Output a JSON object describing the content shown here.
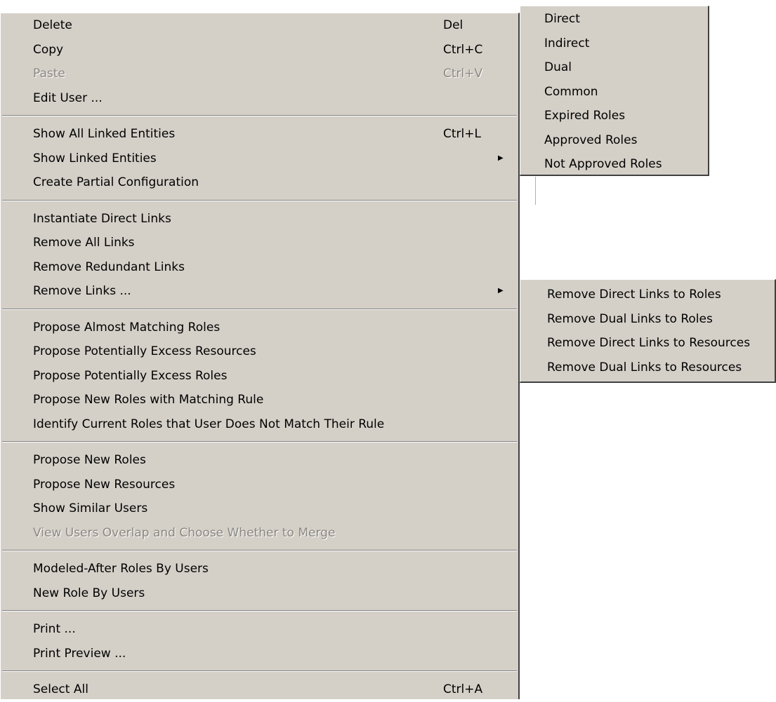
{
  "main_menu": {
    "groups": [
      [
        {
          "label": "Delete",
          "shortcut": "Del",
          "disabled": false
        },
        {
          "label": "Copy",
          "shortcut": "Ctrl+C",
          "disabled": false
        },
        {
          "label": "Paste",
          "shortcut": "Ctrl+V",
          "disabled": true
        },
        {
          "label": "Edit User ...",
          "shortcut": "",
          "disabled": false
        }
      ],
      [
        {
          "label": "Show All Linked Entities",
          "shortcut": "Ctrl+L",
          "disabled": false
        },
        {
          "label": "Show Linked Entities",
          "shortcut": "",
          "submenu": true,
          "disabled": false
        },
        {
          "label": "Create Partial Configuration",
          "shortcut": "",
          "disabled": false
        }
      ],
      [
        {
          "label": "Instantiate Direct Links",
          "shortcut": "",
          "disabled": false
        },
        {
          "label": "Remove All Links",
          "shortcut": "",
          "disabled": false
        },
        {
          "label": "Remove Redundant Links",
          "shortcut": "",
          "disabled": false
        },
        {
          "label": "Remove Links ...",
          "shortcut": "",
          "submenu": true,
          "disabled": false
        }
      ],
      [
        {
          "label": "Propose Almost Matching Roles",
          "shortcut": "",
          "disabled": false
        },
        {
          "label": "Propose Potentially Excess Resources",
          "shortcut": "",
          "disabled": false
        },
        {
          "label": "Propose Potentially Excess Roles",
          "shortcut": "",
          "disabled": false
        },
        {
          "label": "Propose New Roles with Matching Rule",
          "shortcut": "",
          "disabled": false
        },
        {
          "label": "Identify Current Roles that User Does Not Match Their Rule",
          "shortcut": "",
          "disabled": false
        }
      ],
      [
        {
          "label": "Propose New Roles",
          "shortcut": "",
          "disabled": false
        },
        {
          "label": "Propose New Resources",
          "shortcut": "",
          "disabled": false
        },
        {
          "label": "Show Similar Users",
          "shortcut": "",
          "disabled": false
        },
        {
          "label": "View Users Overlap and Choose Whether to Merge",
          "shortcut": "",
          "disabled": true
        }
      ],
      [
        {
          "label": "Modeled-After Roles By Users",
          "shortcut": "",
          "disabled": false
        },
        {
          "label": "New Role By Users",
          "shortcut": "",
          "disabled": false
        }
      ],
      [
        {
          "label": "Print ...",
          "shortcut": "",
          "disabled": false
        },
        {
          "label": "Print Preview ...",
          "shortcut": "",
          "disabled": false
        }
      ],
      [
        {
          "label": "Select All",
          "shortcut": "Ctrl+A",
          "disabled": false
        }
      ]
    ]
  },
  "submenu_linked_entities": {
    "items": [
      "Direct",
      "Indirect",
      "Dual",
      "Common",
      "Expired Roles",
      "Approved Roles",
      "Not Approved Roles"
    ]
  },
  "submenu_remove_links": {
    "items": [
      "Remove Direct Links to Roles",
      "Remove Dual Links to Roles",
      "Remove Direct Links to Resources",
      "Remove Dual Links to Resources"
    ]
  },
  "icons": {
    "submenu_arrow": "submenu-arrow-icon"
  },
  "colors": {
    "menu_bg": "#d4d0c8",
    "disabled_text": "#8a8780",
    "separator_dark": "#808080"
  }
}
